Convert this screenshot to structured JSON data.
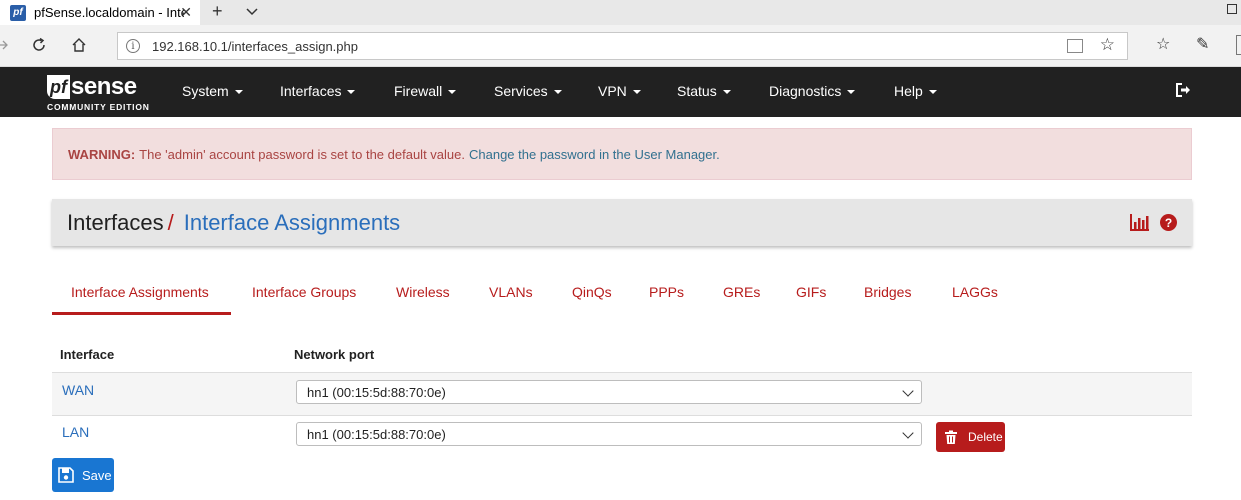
{
  "browser": {
    "tab_title": "pfSense.localdomain - Interfaces: Interface Assignments",
    "favicon_text": "pf",
    "url": "192.168.10.1/interfaces_assign.php"
  },
  "navbar": {
    "logo_pf": "pf",
    "logo_sense": "sense",
    "logo_sub": "COMMUNITY EDITION",
    "menu": [
      "System",
      "Interfaces",
      "Firewall",
      "Services",
      "VPN",
      "Status",
      "Diagnostics",
      "Help"
    ]
  },
  "alert": {
    "label": "WARNING:",
    "message": "The 'admin' account password is set to the default value.",
    "link": "Change the password in the User Manager."
  },
  "breadcrumb": {
    "part1": "Interfaces",
    "separator": "/",
    "part2": "Interface Assignments"
  },
  "tabs": [
    "Interface Assignments",
    "Interface Groups",
    "Wireless",
    "VLANs",
    "QinQs",
    "PPPs",
    "GREs",
    "GIFs",
    "Bridges",
    "LAGGs"
  ],
  "active_tab": "Interface Assignments",
  "table": {
    "headers": [
      "Interface",
      "Network port"
    ],
    "rows": [
      {
        "interface": "WAN",
        "port": "hn1 (00:15:5d:88:70:0e)"
      },
      {
        "interface": "LAN",
        "port": "hn1 (00:15:5d:88:70:0e)",
        "delete_label": "Delete"
      }
    ]
  },
  "buttons": {
    "save": "Save"
  },
  "colors": {
    "accent_red": "#b71c1c",
    "link_blue": "#2a6ebb",
    "save_blue": "#1976d2",
    "navbar": "#212121",
    "alert_bg": "#f2dede"
  },
  "icons": [
    "search-icon",
    "back-arrow-icon",
    "refresh-icon",
    "home-icon",
    "info-icon",
    "star-icon",
    "favorites-icon",
    "pen-icon",
    "logout-icon",
    "bar-chart-icon",
    "help-icon",
    "trash-icon",
    "save-icon"
  ]
}
